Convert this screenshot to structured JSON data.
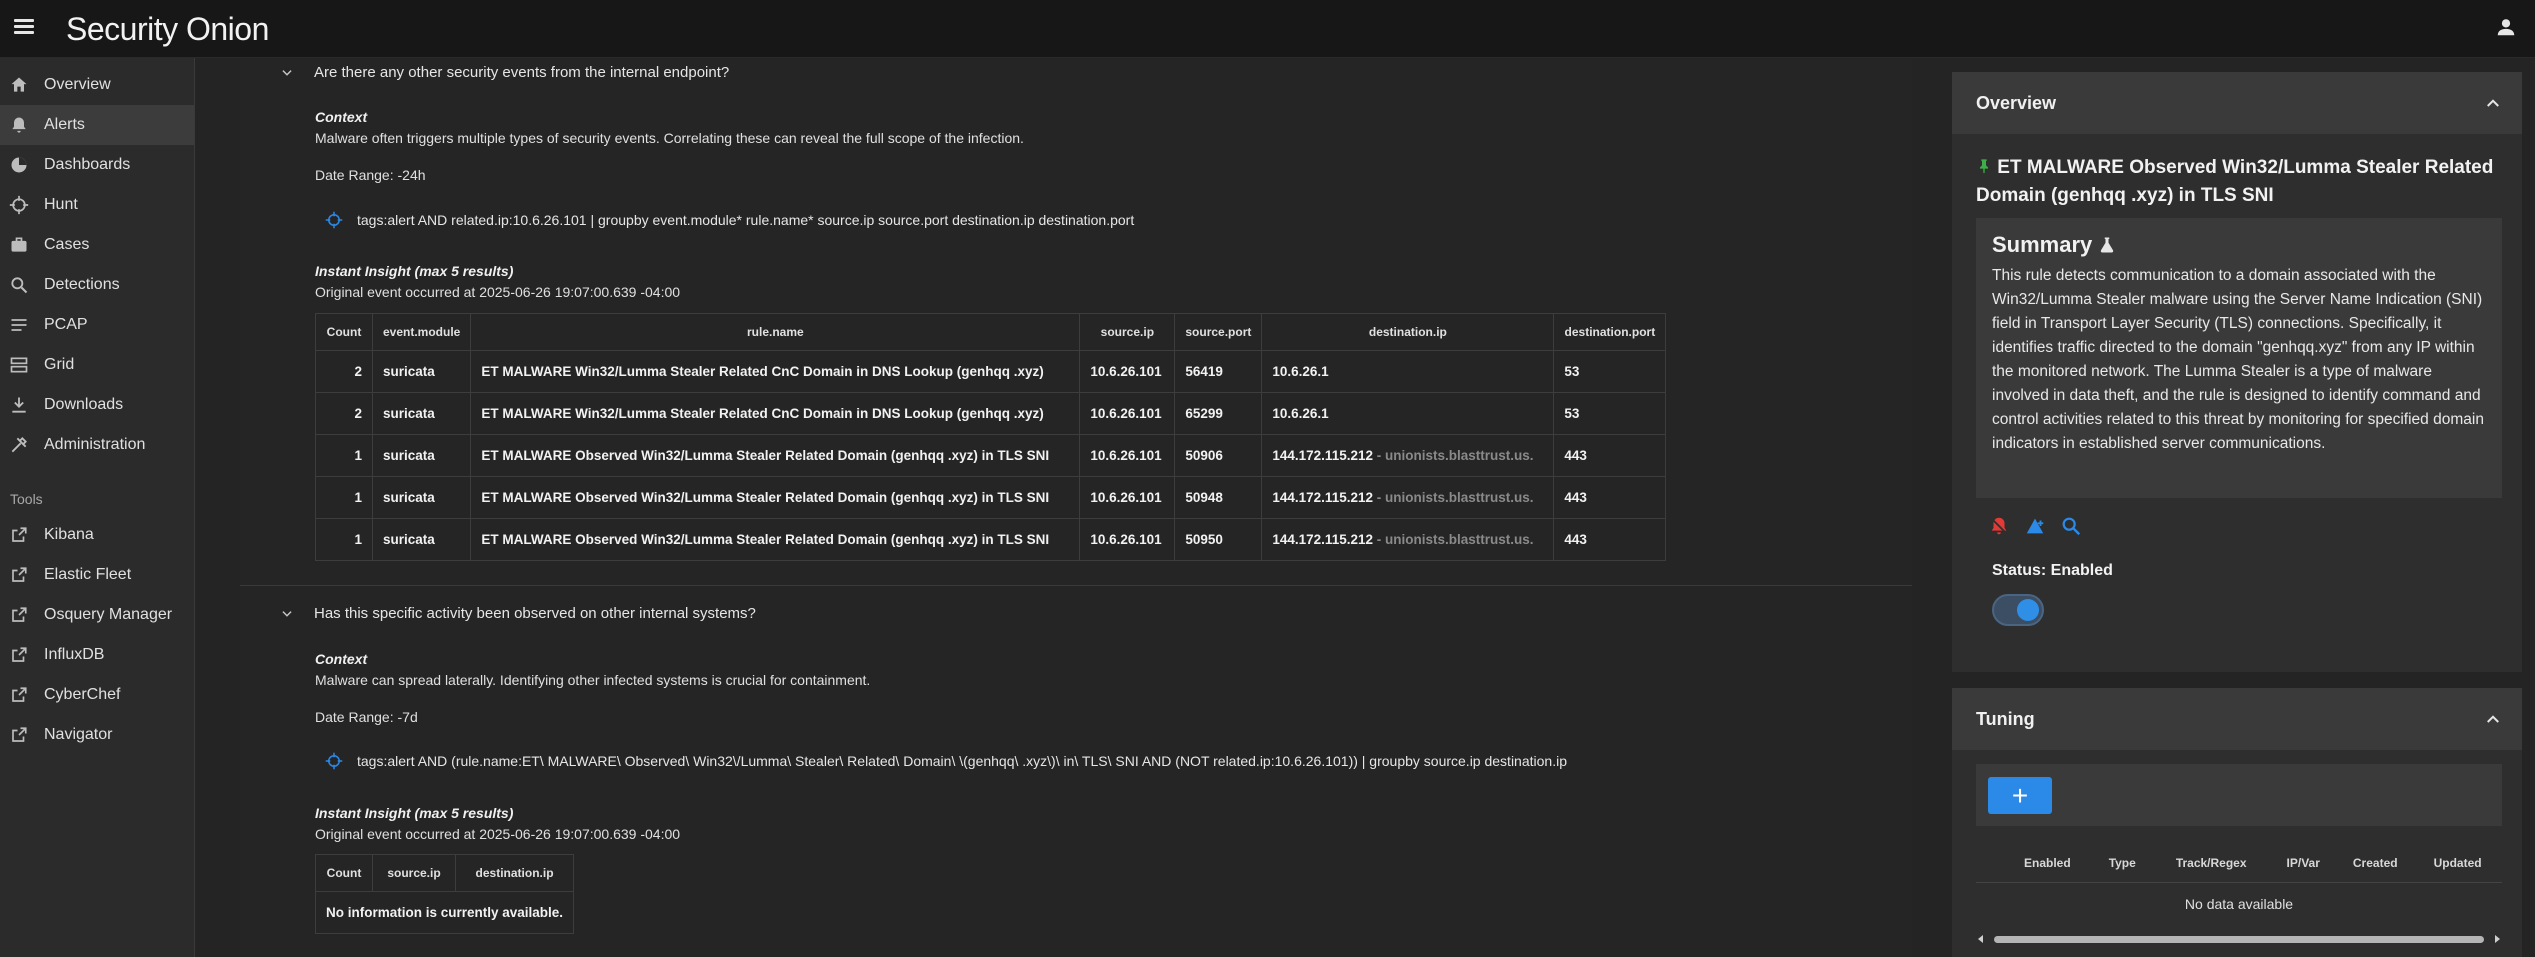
{
  "app": {
    "logo": "Security Onion"
  },
  "sidebar": {
    "items": [
      {
        "label": "Overview",
        "icon": "home-icon"
      },
      {
        "label": "Alerts",
        "icon": "bell-icon",
        "active": true
      },
      {
        "label": "Dashboards",
        "icon": "dashboard-icon"
      },
      {
        "label": "Hunt",
        "icon": "crosshair-icon"
      },
      {
        "label": "Cases",
        "icon": "briefcase-icon"
      },
      {
        "label": "Detections",
        "icon": "search-icon"
      },
      {
        "label": "PCAP",
        "icon": "list-icon"
      },
      {
        "label": "Grid",
        "icon": "grid-icon"
      },
      {
        "label": "Downloads",
        "icon": "download-icon"
      },
      {
        "label": "Administration",
        "icon": "wrench-icon"
      }
    ],
    "tools_label": "Tools",
    "tools": [
      {
        "label": "Kibana"
      },
      {
        "label": "Elastic Fleet"
      },
      {
        "label": "Osquery Manager"
      },
      {
        "label": "InfluxDB"
      },
      {
        "label": "CyberChef"
      },
      {
        "label": "Navigator"
      }
    ]
  },
  "questions": [
    {
      "question": "Are there any other security events from the internal endpoint?",
      "context_title": "Context",
      "context": "Malware often triggers multiple types of security events. Correlating these can reveal the full scope of the infection.",
      "date_range": "Date Range: -24h",
      "query": "tags:alert AND related.ip:10.6.26.101 | groupby event.module* rule.name* source.ip source.port destination.ip destination.port",
      "insight_title": "Instant Insight (max 5 results)",
      "original_event": "Original event occurred at 2025-06-26 19:07:00.639 -04:00",
      "columns": [
        "Count",
        "event.module",
        "rule.name",
        "source.ip",
        "source.port",
        "destination.ip",
        "destination.port"
      ],
      "rows": [
        {
          "count": "2",
          "module": "suricata",
          "rule": "ET MALWARE Win32/Lumma Stealer Related CnC Domain in DNS Lookup (genhqq .xyz)",
          "sip": "10.6.26.101",
          "sport": "56419",
          "dip": "10.6.26.1",
          "dhost": "",
          "dport": "53"
        },
        {
          "count": "2",
          "module": "suricata",
          "rule": "ET MALWARE Win32/Lumma Stealer Related CnC Domain in DNS Lookup (genhqq .xyz)",
          "sip": "10.6.26.101",
          "sport": "65299",
          "dip": "10.6.26.1",
          "dhost": "",
          "dport": "53"
        },
        {
          "count": "1",
          "module": "suricata",
          "rule": "ET MALWARE Observed Win32/Lumma Stealer Related Domain (genhqq .xyz) in TLS SNI",
          "sip": "10.6.26.101",
          "sport": "50906",
          "dip": "144.172.115.212",
          "dhost": " - unionists.blasttrust.us.",
          "dport": "443"
        },
        {
          "count": "1",
          "module": "suricata",
          "rule": "ET MALWARE Observed Win32/Lumma Stealer Related Domain (genhqq .xyz) in TLS SNI",
          "sip": "10.6.26.101",
          "sport": "50948",
          "dip": "144.172.115.212",
          "dhost": " - unionists.blasttrust.us.",
          "dport": "443"
        },
        {
          "count": "1",
          "module": "suricata",
          "rule": "ET MALWARE Observed Win32/Lumma Stealer Related Domain (genhqq .xyz) in TLS SNI",
          "sip": "10.6.26.101",
          "sport": "50950",
          "dip": "144.172.115.212",
          "dhost": " - unionists.blasttrust.us.",
          "dport": "443"
        }
      ]
    },
    {
      "question": "Has this specific activity been observed on other internal systems?",
      "context_title": "Context",
      "context": "Malware can spread laterally. Identifying other infected systems is crucial for containment.",
      "date_range": "Date Range: -7d",
      "query": "tags:alert AND (rule.name:ET\\ MALWARE\\ Observed\\ Win32\\/Lumma\\ Stealer\\ Related\\ Domain\\ \\(genhqq\\ .xyz\\)\\ in\\ TLS\\ SNI AND (NOT related.ip:10.6.26.101)) | groupby source.ip destination.ip",
      "insight_title": "Instant Insight (max 5 results)",
      "original_event": "Original event occurred at 2025-06-26 19:07:00.639 -04:00",
      "columns": [
        "Count",
        "source.ip",
        "destination.ip"
      ],
      "empty_text": "No information is currently available."
    }
  ],
  "overview": {
    "header": "Overview",
    "rule_title": "ET MALWARE Observed Win32/Lumma Stealer Related Domain (genhqq .xyz) in TLS SNI",
    "summary_title": "Summary",
    "summary_text": "This rule detects communication to a domain associated with the Win32/Lumma Stealer malware using the Server Name Indication (SNI) field in Transport Layer Security (TLS) connections. Specifically, it identifies traffic directed to the domain \"genhqq.xyz\" from any IP within the monitored network. The Lumma Stealer is a type of malware involved in data theft, and the rule is designed to identify command and control activities related to this threat by monitoring for specified domain indicators in established server communications.",
    "status": "Status: Enabled",
    "colors": {
      "pin": "#3fae49",
      "alert": "#e53935",
      "accent": "#2b8ae8"
    }
  },
  "tuning": {
    "header": "Tuning",
    "add_label": "+",
    "columns": [
      "Enabled",
      "Type",
      "Track/Regex",
      "IP/Var",
      "Created",
      "Updated"
    ],
    "empty_text": "No data available"
  }
}
